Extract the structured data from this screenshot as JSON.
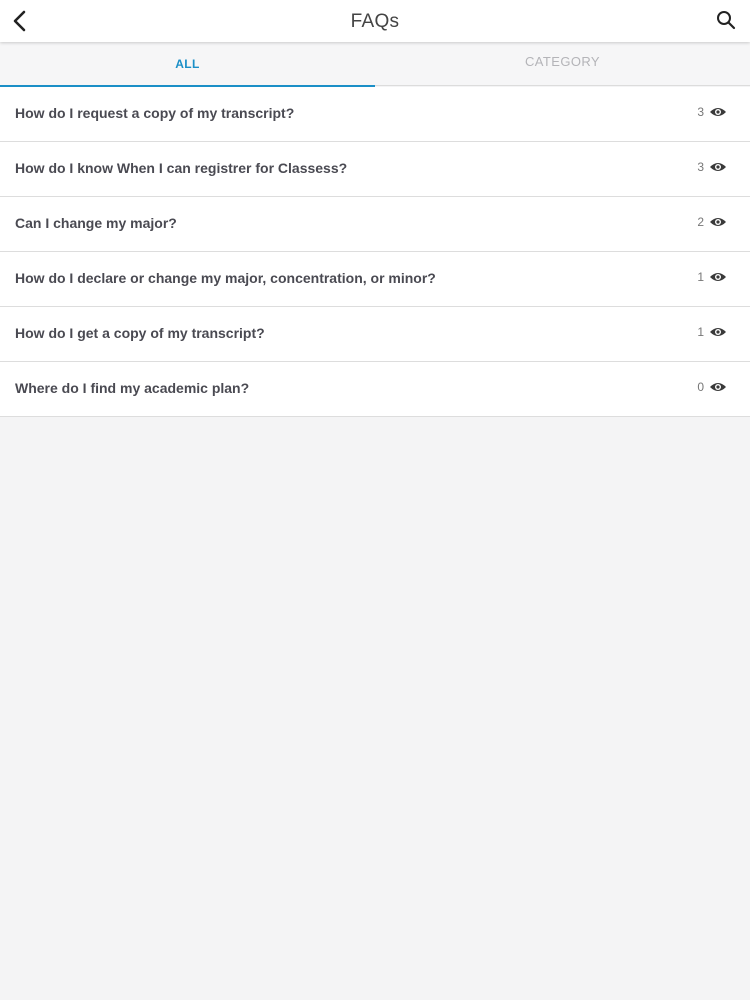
{
  "header": {
    "title": "FAQs",
    "back_icon": "chevron-left-icon",
    "search_icon": "search-icon"
  },
  "tabs": [
    {
      "label": "ALL",
      "active": true
    },
    {
      "label": "CATEGORY",
      "active": false
    }
  ],
  "colors": {
    "accent": "#1b8fc7",
    "background": "#f4f4f5",
    "text": "#4a4a52"
  },
  "faqs": [
    {
      "question": "How do I request a copy of my transcript?",
      "views": "3"
    },
    {
      "question": "How do I know When I can registrer for Classess?",
      "views": "3"
    },
    {
      "question": "Can I change my major?",
      "views": "2"
    },
    {
      "question": "How do I declare or change my major, concentration, or minor?",
      "views": "1"
    },
    {
      "question": "How do I get a copy of my transcript?",
      "views": "1"
    },
    {
      "question": "Where do I find my academic plan?",
      "views": "0"
    }
  ],
  "view_icon": "eye-icon"
}
